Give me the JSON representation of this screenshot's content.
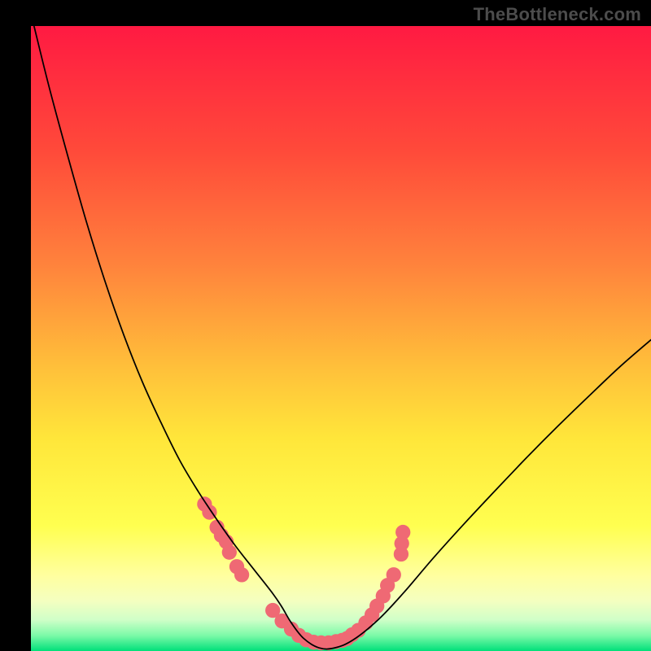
{
  "watermark": "TheBottleneck.com",
  "chart_data": {
    "type": "line",
    "title": "",
    "xlabel": "",
    "ylabel": "",
    "xlim": [
      0,
      1000
    ],
    "ylim": [
      0,
      1000
    ],
    "grid": false,
    "legend": false,
    "background_gradient": {
      "top": "#ff1a42",
      "mid_upper": "#ff823c",
      "mid": "#ffe63a",
      "mid_lower": "#ffff60",
      "near_bottom": "#e7ffb0",
      "bottom": "#00e07a"
    },
    "series": [
      {
        "name": "curve",
        "color": "#000000",
        "x": [
          5,
          30,
          60,
          90,
          120,
          150,
          180,
          210,
          240,
          270,
          300,
          330,
          360,
          390,
          405,
          420,
          440,
          465,
          490,
          520,
          560,
          600,
          650,
          700,
          750,
          800,
          850,
          900,
          950,
          1000
        ],
        "y": [
          1000,
          900,
          790,
          685,
          590,
          505,
          430,
          365,
          305,
          255,
          210,
          168,
          130,
          92,
          70,
          45,
          20,
          5,
          5,
          18,
          50,
          92,
          150,
          205,
          258,
          310,
          360,
          408,
          455,
          498
        ]
      }
    ],
    "markers": [
      {
        "name": "highlight-dots",
        "color": "#ef6974",
        "radius": 12,
        "points": [
          {
            "x": 280,
            "y": 235
          },
          {
            "x": 288,
            "y": 222
          },
          {
            "x": 300,
            "y": 198
          },
          {
            "x": 307,
            "y": 185
          },
          {
            "x": 315,
            "y": 175
          },
          {
            "x": 320,
            "y": 158
          },
          {
            "x": 332,
            "y": 135
          },
          {
            "x": 340,
            "y": 122
          },
          {
            "x": 390,
            "y": 65
          },
          {
            "x": 405,
            "y": 48
          },
          {
            "x": 420,
            "y": 35
          },
          {
            "x": 432,
            "y": 25
          },
          {
            "x": 444,
            "y": 18
          },
          {
            "x": 456,
            "y": 14
          },
          {
            "x": 468,
            "y": 13
          },
          {
            "x": 480,
            "y": 13
          },
          {
            "x": 492,
            "y": 15
          },
          {
            "x": 502,
            "y": 17
          },
          {
            "x": 510,
            "y": 20
          },
          {
            "x": 518,
            "y": 26
          },
          {
            "x": 528,
            "y": 33
          },
          {
            "x": 540,
            "y": 45
          },
          {
            "x": 550,
            "y": 58
          },
          {
            "x": 558,
            "y": 72
          },
          {
            "x": 568,
            "y": 88
          },
          {
            "x": 575,
            "y": 105
          },
          {
            "x": 585,
            "y": 122
          },
          {
            "x": 597,
            "y": 155
          },
          {
            "x": 598,
            "y": 172
          },
          {
            "x": 600,
            "y": 190
          }
        ]
      }
    ]
  }
}
